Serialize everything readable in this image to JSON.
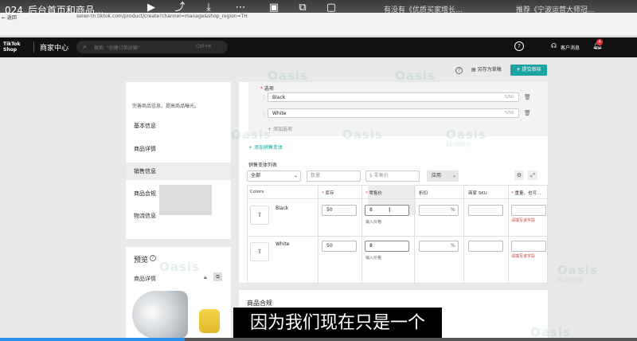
{
  "video": {
    "title": "024_后台首页和商品...",
    "right_text_1": "有没有《优质买家增长...",
    "right_text_2": "推荐《宁波运营大师冠..."
  },
  "browser": {
    "back_label": "← 返回",
    "url": "seller-th.tiktok.com/product/create?channel=manage&shop_region=TH"
  },
  "header": {
    "logo_line1": "TikTok",
    "logo_line2": "Shop",
    "brand": "商家中心",
    "search_placeholder": "搜索: \"创建订单运输\"",
    "search_shortcut": "Ctrl+K",
    "help_icon": "?",
    "customer_service": "客户消息",
    "notification_count": "4"
  },
  "toolbar": {
    "help_icon": "?",
    "save_draft": "另存为草稿",
    "submit": "提交审核"
  },
  "left_nav": {
    "description": "完善商品信息，提高商品曝光。",
    "items": [
      {
        "label": "基本信息"
      },
      {
        "label": "商品详情"
      },
      {
        "label": "销售信息"
      },
      {
        "label": "商品合规"
      },
      {
        "label": "物流信息"
      }
    ]
  },
  "preview": {
    "title": "预览",
    "subtitle": "商品详情"
  },
  "options": {
    "label": "选项",
    "items": [
      {
        "value": "Black",
        "count": "5/50"
      },
      {
        "value": "White",
        "count": "5/50"
      }
    ],
    "add_option": "添加选项",
    "add_variant": "添加销售变体"
  },
  "variant_list": {
    "title": "销售变体列表",
    "filter_all": "全部",
    "stock_placeholder": "数量",
    "price_placeholder": "$ 零售价",
    "apply": "应用",
    "columns": [
      "Colors",
      "库存",
      "零售价",
      "折扣",
      "商家 SKU",
      "重量、也可..."
    ],
    "rows": [
      {
        "name": "Black",
        "stock": "50",
        "price": "8",
        "price_hint": "输入价格",
        "pct": "%",
        "error": "请填写该字段"
      },
      {
        "name": "White",
        "stock": "50",
        "price": "8",
        "price_hint": "输入价格",
        "pct": "%",
        "error": "请填写该字段"
      }
    ]
  },
  "compliance": {
    "title": "商品合规"
  },
  "subtitle": "因为我们现在只是一个",
  "watermark": {
    "brand": "Oasis",
    "cn": "绿洲跨境"
  },
  "progress": 0.29,
  "colors": {
    "accent": "#1aa3a3",
    "error": "#d43b3b",
    "header_bg": "#111111"
  }
}
